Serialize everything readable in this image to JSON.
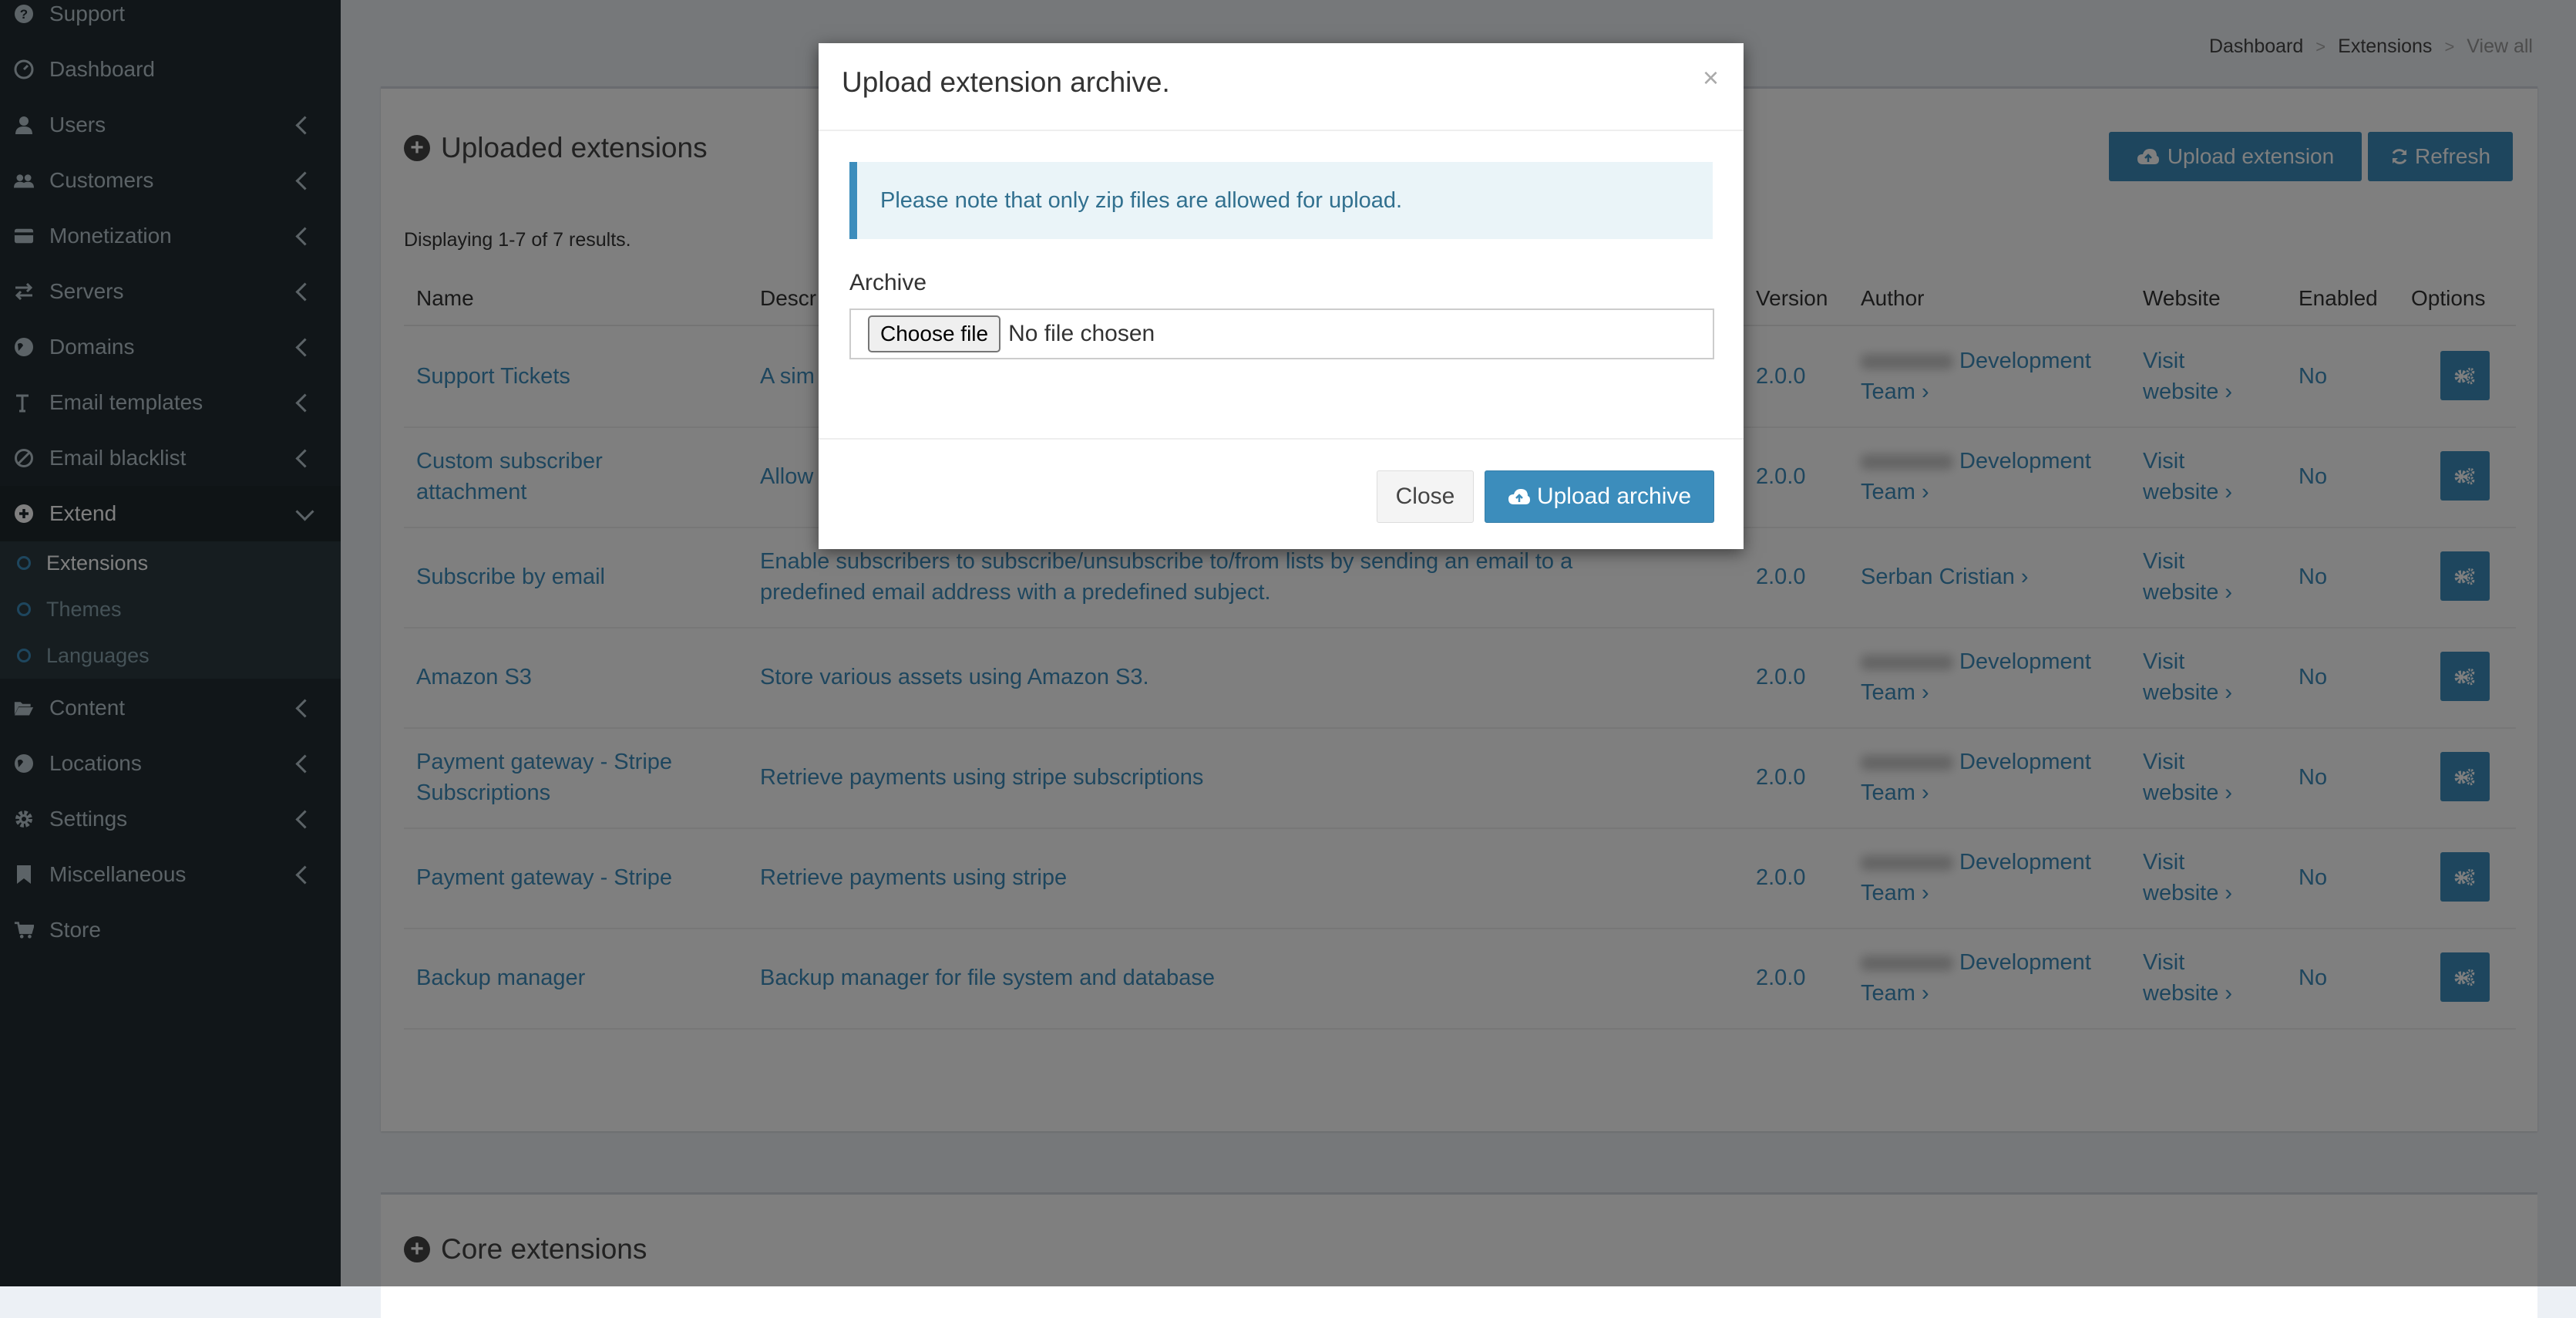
{
  "sidebar": {
    "items": [
      {
        "label": "Support",
        "icon": "question-circle-icon",
        "chevron": false
      },
      {
        "label": "Dashboard",
        "icon": "dashboard-icon",
        "chevron": false
      },
      {
        "label": "Users",
        "icon": "user-icon",
        "chevron": true
      },
      {
        "label": "Customers",
        "icon": "users-icon",
        "chevron": true
      },
      {
        "label": "Monetization",
        "icon": "credit-card-icon",
        "chevron": true
      },
      {
        "label": "Servers",
        "icon": "exchange-icon",
        "chevron": true
      },
      {
        "label": "Domains",
        "icon": "globe-icon",
        "chevron": true
      },
      {
        "label": "Email templates",
        "icon": "text-height-icon",
        "chevron": true
      },
      {
        "label": "Email blacklist",
        "icon": "ban-icon",
        "chevron": true
      },
      {
        "label": "Extend",
        "icon": "plus-circle-icon",
        "chevron": true,
        "expanded": true
      },
      {
        "label": "Content",
        "icon": "folder-open-icon",
        "chevron": true
      },
      {
        "label": "Locations",
        "icon": "globe-icon",
        "chevron": true
      },
      {
        "label": "Settings",
        "icon": "gear-icon",
        "chevron": true
      },
      {
        "label": "Miscellaneous",
        "icon": "bookmark-icon",
        "chevron": true
      },
      {
        "label": "Store",
        "icon": "cart-icon",
        "chevron": false
      }
    ],
    "submenu": [
      {
        "label": "Extensions",
        "active": true
      },
      {
        "label": "Themes",
        "active": false
      },
      {
        "label": "Languages",
        "active": false
      }
    ]
  },
  "breadcrumb": {
    "items": [
      "Dashboard",
      "Extensions",
      "View all"
    ]
  },
  "uploaded_box": {
    "title": "Uploaded extensions",
    "upload_button": "Upload extension",
    "refresh_button": "Refresh",
    "summary": "Displaying 1-7 of 7 results.",
    "columns": [
      "Name",
      "Descr",
      "Version",
      "Author",
      "Website",
      "Enabled",
      "Options"
    ],
    "rows": [
      {
        "name": [
          "Support Tickets"
        ],
        "description": [
          "A sim"
        ],
        "version": "2.0.0",
        "author": [
          "Development",
          "Team ›"
        ],
        "author_blur": true,
        "website": [
          "Visit",
          "website ›"
        ],
        "enabled": "No"
      },
      {
        "name": [
          "Custom subscriber",
          "attachment"
        ],
        "description": [
          "Allow"
        ],
        "version": "2.0.0",
        "author": [
          "Development",
          "Team ›"
        ],
        "author_blur": true,
        "website": [
          "Visit",
          "website ›"
        ],
        "enabled": "No"
      },
      {
        "name": [
          "Subscribe by email"
        ],
        "description": [
          "Enable subscribers to subscribe/unsubscribe to/from lists by sending an email to a",
          "predefined email address with a predefined subject."
        ],
        "version": "2.0.0",
        "author": [
          "Serban Cristian ›"
        ],
        "author_blur": false,
        "website": [
          "Visit",
          "website ›"
        ],
        "enabled": "No"
      },
      {
        "name": [
          "Amazon S3"
        ],
        "description": [
          "Store various assets using Amazon S3."
        ],
        "version": "2.0.0",
        "author": [
          "Development",
          "Team ›"
        ],
        "author_blur": true,
        "website": [
          "Visit",
          "website ›"
        ],
        "enabled": "No"
      },
      {
        "name": [
          "Payment gateway - Stripe",
          "Subscriptions"
        ],
        "description": [
          "Retrieve payments using stripe subscriptions"
        ],
        "version": "2.0.0",
        "author": [
          "Development",
          "Team ›"
        ],
        "author_blur": true,
        "website": [
          "Visit",
          "website ›"
        ],
        "enabled": "No"
      },
      {
        "name": [
          "Payment gateway - Stripe"
        ],
        "description": [
          "Retrieve payments using stripe"
        ],
        "version": "2.0.0",
        "author": [
          "Development",
          "Team ›"
        ],
        "author_blur": true,
        "website": [
          "Visit",
          "website ›"
        ],
        "enabled": "No"
      },
      {
        "name": [
          "Backup manager"
        ],
        "description": [
          "Backup manager for file system and database"
        ],
        "version": "2.0.0",
        "author": [
          "Development",
          "Team ›"
        ],
        "author_blur": true,
        "website": [
          "Visit",
          "website ›"
        ],
        "enabled": "No"
      }
    ]
  },
  "core_box": {
    "title": "Core extensions"
  },
  "modal": {
    "title": "Upload extension archive.",
    "close_symbol": "×",
    "alert": "Please note that only zip files are allowed for upload.",
    "field_label": "Archive",
    "choose_file": "Choose file",
    "no_file": "No file chosen",
    "close_button": "Close",
    "upload_button": "Upload archive"
  },
  "colors": {
    "accent": "#3c8dbc",
    "sidebar_bg": "#222d32",
    "overlay": "rgba(0,0,0,0.5)"
  }
}
